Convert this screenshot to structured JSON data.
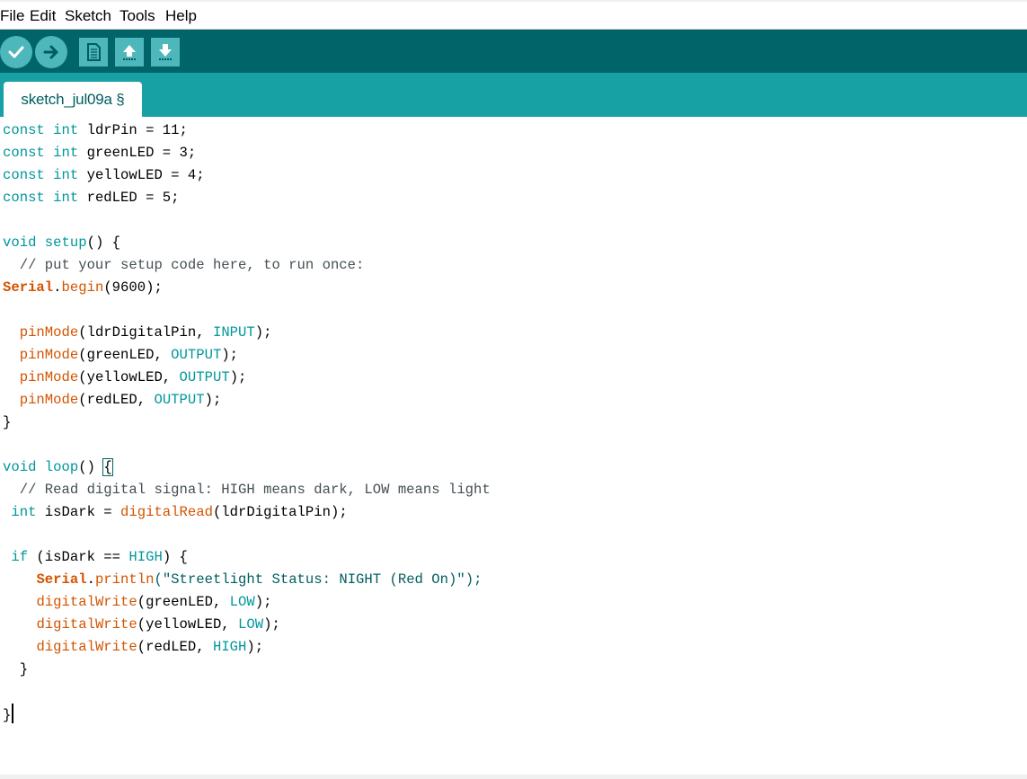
{
  "menu": {
    "items": [
      "File",
      "Edit",
      "Sketch",
      "Tools",
      "Help"
    ]
  },
  "toolbar": {
    "buttons": [
      {
        "name": "verify",
        "icon": "checkmark-icon"
      },
      {
        "name": "upload",
        "icon": "arrow-right-icon"
      },
      {
        "name": "new",
        "icon": "document-icon"
      },
      {
        "name": "open",
        "icon": "arrow-up-icon"
      },
      {
        "name": "save",
        "icon": "arrow-down-icon"
      }
    ]
  },
  "tab": {
    "label": "sketch_jul09a §"
  },
  "code": {
    "lines": [
      [
        {
          "t": "const",
          "c": "kw"
        },
        {
          "t": " "
        },
        {
          "t": "int",
          "c": "kw"
        },
        {
          "t": " ldrPin = 11;"
        }
      ],
      [
        {
          "t": "const",
          "c": "kw"
        },
        {
          "t": " "
        },
        {
          "t": "int",
          "c": "kw"
        },
        {
          "t": " greenLED = 3;"
        }
      ],
      [
        {
          "t": "const",
          "c": "kw"
        },
        {
          "t": " "
        },
        {
          "t": "int",
          "c": "kw"
        },
        {
          "t": " yellowLED = 4;"
        }
      ],
      [
        {
          "t": "const",
          "c": "kw"
        },
        {
          "t": " "
        },
        {
          "t": "int",
          "c": "kw"
        },
        {
          "t": " redLED = 5;"
        }
      ],
      [],
      [
        {
          "t": "void",
          "c": "kw"
        },
        {
          "t": " "
        },
        {
          "t": "setup",
          "c": "kw"
        },
        {
          "t": "() {"
        }
      ],
      [
        {
          "t": "  // put your setup code here, to run once:",
          "c": "cm"
        }
      ],
      [
        {
          "t": "Serial",
          "c": "ser"
        },
        {
          "t": "."
        },
        {
          "t": "begin",
          "c": "fn"
        },
        {
          "t": "(9600);"
        }
      ],
      [],
      [
        {
          "t": "  "
        },
        {
          "t": "pinMode",
          "c": "fn"
        },
        {
          "t": "(ldrDigitalPin, "
        },
        {
          "t": "INPUT",
          "c": "kw"
        },
        {
          "t": ");"
        }
      ],
      [
        {
          "t": "  "
        },
        {
          "t": "pinMode",
          "c": "fn"
        },
        {
          "t": "(greenLED, "
        },
        {
          "t": "OUTPUT",
          "c": "kw"
        },
        {
          "t": ");"
        }
      ],
      [
        {
          "t": "  "
        },
        {
          "t": "pinMode",
          "c": "fn"
        },
        {
          "t": "(yellowLED, "
        },
        {
          "t": "OUTPUT",
          "c": "kw"
        },
        {
          "t": ");"
        }
      ],
      [
        {
          "t": "  "
        },
        {
          "t": "pinMode",
          "c": "fn"
        },
        {
          "t": "(redLED, "
        },
        {
          "t": "OUTPUT",
          "c": "kw"
        },
        {
          "t": ");"
        }
      ],
      [
        {
          "t": "}"
        }
      ],
      [],
      [
        {
          "t": "void",
          "c": "kw"
        },
        {
          "t": " "
        },
        {
          "t": "loop",
          "c": "kw"
        },
        {
          "t": "() "
        },
        {
          "t": "{",
          "c": "brace-box"
        }
      ],
      [
        {
          "t": "  // Read digital signal: HIGH means dark, LOW means light",
          "c": "cm"
        }
      ],
      [
        {
          "t": " "
        },
        {
          "t": "int",
          "c": "kw"
        },
        {
          "t": " isDark = "
        },
        {
          "t": "digitalRead",
          "c": "fn"
        },
        {
          "t": "(ldrDigitalPin);"
        }
      ],
      [],
      [
        {
          "t": " "
        },
        {
          "t": "if",
          "c": "kw"
        },
        {
          "t": " (isDark == "
        },
        {
          "t": "HIGH",
          "c": "kw"
        },
        {
          "t": ") {"
        }
      ],
      [
        {
          "t": "    "
        },
        {
          "t": "Serial",
          "c": "ser"
        },
        {
          "t": "."
        },
        {
          "t": "println",
          "c": "fn"
        },
        {
          "t": "(\"Streetlight Status: NIGHT (Red On)\");",
          "c": "str"
        }
      ],
      [
        {
          "t": "    "
        },
        {
          "t": "digitalWrite",
          "c": "fn"
        },
        {
          "t": "(greenLED, "
        },
        {
          "t": "LOW",
          "c": "kw"
        },
        {
          "t": ");"
        }
      ],
      [
        {
          "t": "    "
        },
        {
          "t": "digitalWrite",
          "c": "fn"
        },
        {
          "t": "(yellowLED, "
        },
        {
          "t": "LOW",
          "c": "kw"
        },
        {
          "t": ");"
        }
      ],
      [
        {
          "t": "    "
        },
        {
          "t": "digitalWrite",
          "c": "fn"
        },
        {
          "t": "(redLED, "
        },
        {
          "t": "HIGH",
          "c": "kw"
        },
        {
          "t": ");"
        }
      ],
      [
        {
          "t": "  }"
        }
      ],
      [],
      [
        {
          "t": "}"
        },
        {
          "t": "",
          "c": "caret"
        }
      ]
    ]
  },
  "colors": {
    "toolbar_bg": "#006468",
    "tabbar_bg": "#17a1a5",
    "button_bg": "#4db7bb",
    "keyword": "#00979c",
    "function": "#d35400",
    "comment": "#434f54"
  }
}
